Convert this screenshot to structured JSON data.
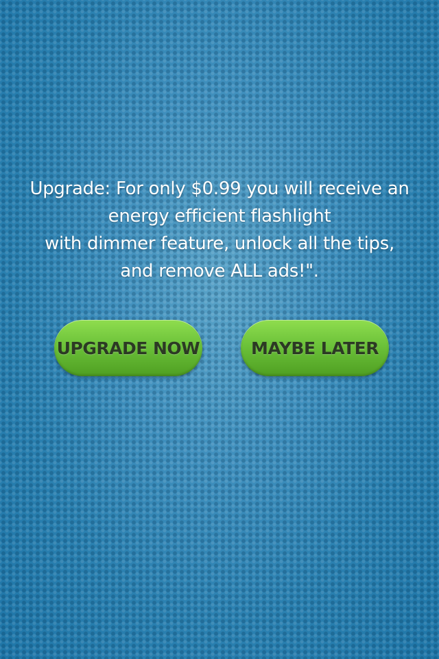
{
  "colors": {
    "background": "#2f86b6",
    "button": "#6cc23a",
    "button_text": "#2c3a24",
    "message_text": "#ffffff"
  },
  "message": {
    "lines": [
      "Upgrade:  For only $0.99 you will receive an",
      "energy efficient flashlight",
      "with dimmer feature, unlock all the tips,",
      "and remove ALL ads!\"."
    ]
  },
  "buttons": {
    "upgrade_label": "UPGRADE NOW",
    "later_label": "MAYBE LATER"
  }
}
